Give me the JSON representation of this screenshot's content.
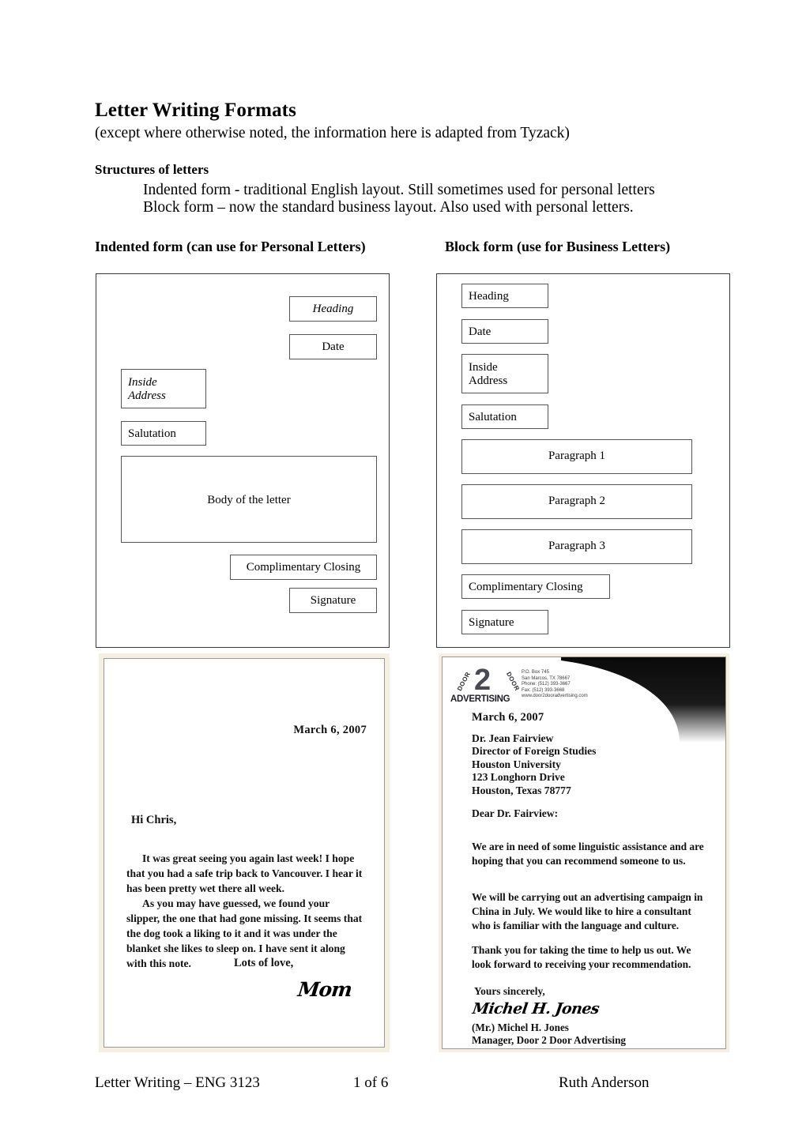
{
  "document": {
    "title": "Letter Writing Formats",
    "subtitle": "(except where otherwise noted, the information here is adapted from Tyzack)",
    "structures": {
      "heading": "Structures of letters",
      "line1": "Indented form - traditional English layout. Still sometimes used for personal letters",
      "line2": "Block form – now the standard business layout. Also used with personal letters."
    },
    "columns": {
      "left_heading": "Indented form (can use for Personal Letters)",
      "right_heading": "Block form (use for Business Letters)"
    }
  },
  "diagram_indented": {
    "boxes": [
      {
        "label": "Heading",
        "style": "italic"
      },
      {
        "label": "Date",
        "style": "normal"
      },
      {
        "label": "Inside\nAddress",
        "style": "italic"
      },
      {
        "label": "Salutation",
        "style": "normal"
      },
      {
        "label": "Body of the letter",
        "style": "normal"
      },
      {
        "label": "Complimentary Closing",
        "style": "normal"
      },
      {
        "label": "Signature",
        "style": "normal"
      }
    ]
  },
  "diagram_block": {
    "boxes": [
      {
        "label": "Heading"
      },
      {
        "label": "Date"
      },
      {
        "label": "Inside\nAddress"
      },
      {
        "label": "Salutation"
      },
      {
        "label": "Paragraph 1"
      },
      {
        "label": "Paragraph 2"
      },
      {
        "label": "Paragraph 3"
      },
      {
        "label": "Complimentary Closing"
      },
      {
        "label": "Signature"
      }
    ]
  },
  "personal_letter": {
    "date": "March 6, 2007",
    "salutation": "Hi Chris,",
    "paragraph_1": "It was great seeing you again last week! I hope that you had a safe trip back to Vancouver. I hear it has been pretty wet there all week.",
    "paragraph_2": "As you may have guessed, we found your slipper, the one that had gone missing. It seems that the dog took a liking to it and it was under the blanket she likes to sleep on. I have sent it along with this note.",
    "closing": "Lots of love,",
    "signature": "Mom"
  },
  "business_letter": {
    "logo": {
      "number": "2",
      "arc_left": "DOOR",
      "arc_right": "DOOR",
      "word": "ADVERTISING",
      "contact": "P.O. Box 745\nSan Marcos, TX 78667\nPhone: (512) 393-3667\nFax: (512) 393-3668\nwww.door2dooradvertising.com"
    },
    "date": "March 6, 2007",
    "inside_address": "Dr. Jean Fairview\nDirector of Foreign Studies\nHouston University\n123 Longhorn Drive\nHouston, Texas  78777",
    "salutation": "Dear Dr. Fairview:",
    "paragraph_1": "We are in need of some linguistic assistance and are hoping that you can recommend someone to us.",
    "paragraph_2": "We will be carrying out an advertising campaign in China in July. We would like to hire a consultant who is familiar with the language and culture.",
    "paragraph_3": "Thank you for taking the time to help us out.  We look forward to receiving your recommendation.",
    "closing": "Yours sincerely,",
    "signature": "Michel H. Jones",
    "signer": "(Mr.) Michel H. Jones\nManager, Door 2 Door Advertising"
  },
  "footer": {
    "left": "Letter Writing – ENG 3123",
    "center": "1 of 6",
    "right": "Ruth Anderson"
  }
}
